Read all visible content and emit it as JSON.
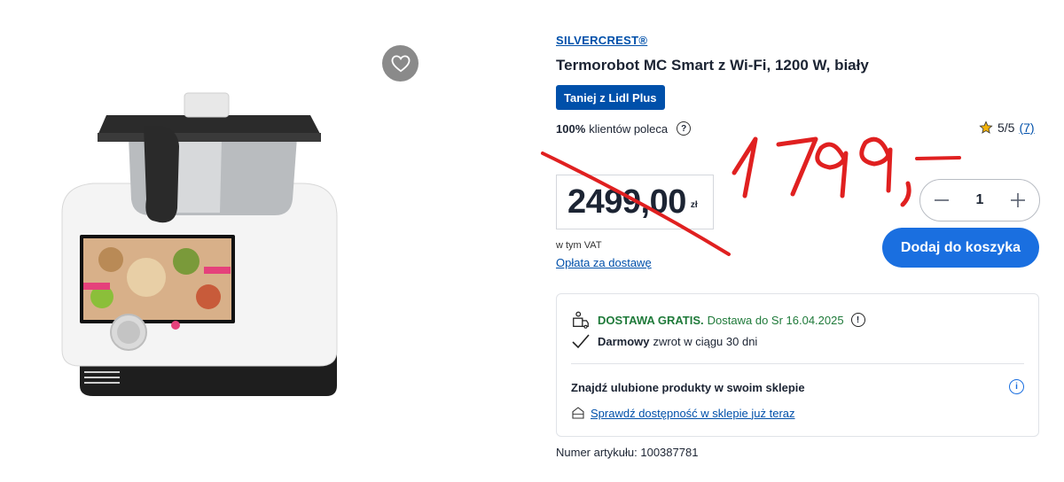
{
  "product": {
    "brand": "SILVERCREST®",
    "title": "Termorobot MC Smart z Wi-Fi, 1200 W, biały",
    "badge": "Taniej z Lidl Plus",
    "recommend_pct": "100%",
    "recommend_text": "klientów poleca",
    "rating": "5/5",
    "rating_count": "(7)"
  },
  "price": {
    "value": "2499,00",
    "currency": "zł",
    "vat_note": "w tym VAT",
    "delivery_fee_link": "Opłata za dostawę"
  },
  "cart": {
    "quantity": "1",
    "add_button": "Dodaj do koszyka"
  },
  "delivery": {
    "free_label": "DOSTAWA GRATIS.",
    "date_text": "Dostawa do Sr 16.04.2025",
    "return_bold": "Darmowy",
    "return_text": "zwrot w ciągu 30 dni",
    "store_title": "Znajdź ulubione produkty w swoim sklepie",
    "store_link": "Sprawdź dostępność w sklepie już teraz"
  },
  "article": "Numer artykułu: 100387781",
  "annotation": {
    "handwritten_price": "1799,–",
    "color": "#e02020"
  },
  "colors": {
    "brand_blue": "#0050aa",
    "button_blue": "#1a6fe0",
    "success_green": "#1f7a3a"
  },
  "icons": [
    "heart-icon",
    "help-icon",
    "star-icon",
    "minus-icon",
    "plus-icon",
    "delivery-box-icon",
    "info-icon",
    "checkmark-icon",
    "store-icon"
  ]
}
